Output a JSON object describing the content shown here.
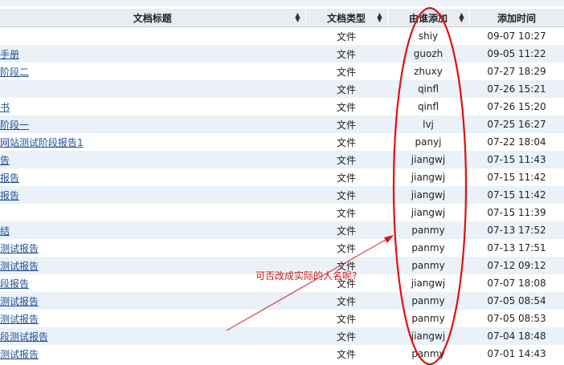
{
  "headers": {
    "title": "文档标题",
    "type": "文档类型",
    "added_by": "由谁添加",
    "added_at": "添加时间"
  },
  "rows": [
    {
      "title": "",
      "type": "文件",
      "user": "shiy",
      "time": "09-07 10:27"
    },
    {
      "title": "手册",
      "type": "文件",
      "user": "guozh",
      "time": "09-05 11:22"
    },
    {
      "title": "阶段二",
      "type": "文件",
      "user": "zhuxy",
      "time": "07-27 18:29"
    },
    {
      "title": "",
      "type": "文件",
      "user": "qinfl",
      "time": "07-26 15:21"
    },
    {
      "title": "书",
      "type": "文件",
      "user": "qinfl",
      "time": "07-26 15:20"
    },
    {
      "title": "阶段一",
      "type": "文件",
      "user": "lvj",
      "time": "07-25 16:27"
    },
    {
      "title": "网站测试阶段报告1",
      "type": "文件",
      "user": "panyj",
      "time": "07-22 18:04"
    },
    {
      "title": "告",
      "type": "文件",
      "user": "jiangwj",
      "time": "07-15 11:43"
    },
    {
      "title": "报告",
      "type": "文件",
      "user": "jiangwj",
      "time": "07-15 11:42"
    },
    {
      "title": "报告",
      "type": "文件",
      "user": "jiangwj",
      "time": "07-15 11:42"
    },
    {
      "title": "",
      "type": "文件",
      "user": "jiangwj",
      "time": "07-15 11:39"
    },
    {
      "title": "结",
      "type": "文件",
      "user": "panmy",
      "time": "07-13 17:52"
    },
    {
      "title": "测试报告",
      "type": "文件",
      "user": "panmy",
      "time": "07-13 17:51"
    },
    {
      "title": "测试报告",
      "type": "文件",
      "user": "panmy",
      "time": "07-12 09:12"
    },
    {
      "title": "段报告",
      "type": "文件",
      "user": "jiangwj",
      "time": "07-07 18:08"
    },
    {
      "title": "测试报告",
      "type": "文件",
      "user": "panmy",
      "time": "07-05 08:54"
    },
    {
      "title": "测试报告",
      "type": "文件",
      "user": "panmy",
      "time": "07-05 08:53"
    },
    {
      "title": "段测试报告",
      "type": "文件",
      "user": "jiangwj",
      "time": "07-04 18:48"
    },
    {
      "title": "测试报告",
      "type": "文件",
      "user": "panmy",
      "time": "07-01 14:43"
    }
  ],
  "annotation": {
    "text": "可否改成实际的人名呢?",
    "color": "#d61515"
  },
  "colors": {
    "header_bg": "#e9edf3",
    "row_alt_bg": "#eaf1f8",
    "link": "#1f4f96"
  }
}
